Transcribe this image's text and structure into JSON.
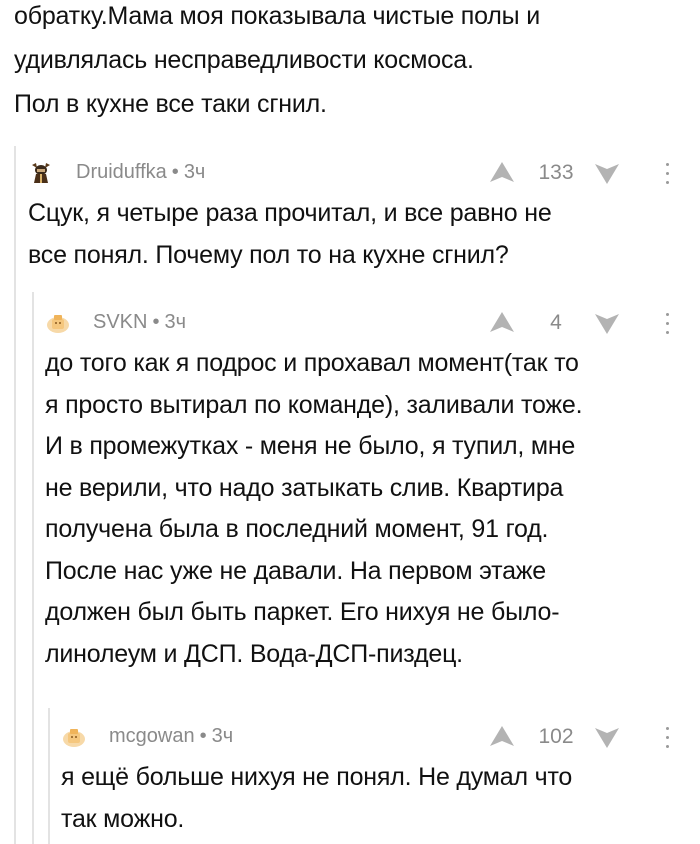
{
  "post": {
    "lines": [
      "обратку.Мама моя показывала чистые полы и",
      "удивлялась несправедливости космоса.",
      "Пол в кухне все таки сгнил."
    ]
  },
  "comments": [
    {
      "author": "Druiduffka",
      "time": "3ч",
      "rating": "133",
      "avatar_icon": "warrior-avatar-icon",
      "lines": [
        "Сцук, я четыре раза прочитал, и все равно не",
        "все понял. Почему пол то на кухне сгнил?"
      ]
    },
    {
      "author": "SVKN",
      "time": "3ч",
      "rating": "4",
      "avatar_icon": "default-avatar-icon",
      "lines": [
        "до того как я подрос и прохавал момент(так то",
        "я просто вытирал по команде), заливали тоже.",
        "И в промежутках - меня не было, я тупил, мне",
        "не верили, что надо затыкать слив. Квартира",
        "получена была в последний момент, 91 год.",
        "После нас уже не давали. На первом этаже",
        "должен был быть паркет. Его нихуя не было-",
        "линолеум и ДСП. Вода-ДСП-пиздец."
      ]
    },
    {
      "author": "mcgowan",
      "time": "3ч",
      "rating": "102",
      "avatar_icon": "default-avatar-icon",
      "lines": [
        "я ещё больше нихуя не понял. Не думал что",
        "так можно."
      ]
    }
  ],
  "separator": "•",
  "colors": {
    "meta": "#8a8a8a",
    "thread_line": "#e3e3e3",
    "arrow": "#b3b3b3"
  }
}
